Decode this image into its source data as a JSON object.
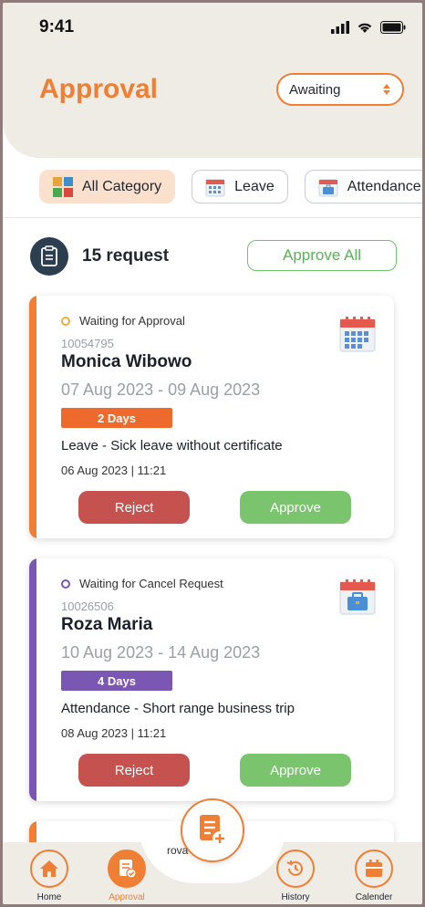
{
  "status_bar": {
    "time": "9:41"
  },
  "header": {
    "title": "Approval",
    "filter_value": "Awaiting"
  },
  "categories": [
    {
      "label": "All Category",
      "icon": "grid-icon"
    },
    {
      "label": "Leave",
      "icon": "calendar-icon"
    },
    {
      "label": "Attendance",
      "icon": "briefcase-icon"
    }
  ],
  "summary": {
    "count_label": "15 request",
    "approve_all_label": "Approve All"
  },
  "requests": [
    {
      "status": "Waiting for Approval",
      "employee_id": "10054795",
      "name": "Monica Wibowo",
      "date_range": "07 Aug 2023 - 09 Aug 2023",
      "duration": "2 Days",
      "type": "Leave - Sick leave without certificate",
      "submitted": "06 Aug 2023 | 11:21",
      "reject_label": "Reject",
      "approve_label": "Approve",
      "accent": "#ee7f34"
    },
    {
      "status": "Waiting for Cancel Request",
      "employee_id": "10026506",
      "name": "Roza Maria",
      "date_range": "10 Aug 2023 - 14 Aug 2023",
      "duration": "4 Days",
      "type": "Attendance - Short range business trip",
      "submitted": "08 Aug 2023 | 11:21",
      "reject_label": "Reject",
      "approve_label": "Approve",
      "accent": "#7b57b4"
    }
  ],
  "peek_card": {
    "partial_text": "rova"
  },
  "bottom_nav": {
    "home": "Home",
    "approval": "Approval",
    "history": "History",
    "calendar": "Calender"
  },
  "colors": {
    "brand": "#ee7f34",
    "reject": "#c5524f",
    "approve": "#7ac46e"
  }
}
